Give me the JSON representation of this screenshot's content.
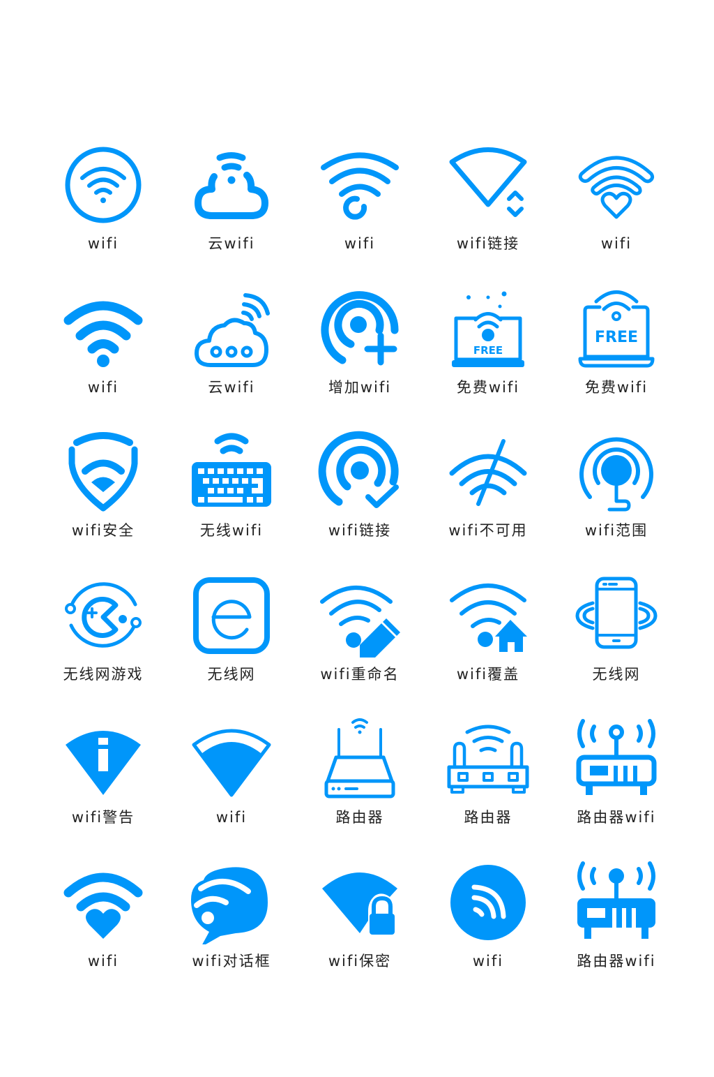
{
  "theme": {
    "icon_color": "#0096fa",
    "label_color": "#222222",
    "background": "#ffffff"
  },
  "icons": [
    {
      "label": "wifi",
      "icon": "wifi-circle-icon"
    },
    {
      "label": "云wifi",
      "icon": "cloud-wifi-icon"
    },
    {
      "label": "wifi",
      "icon": "wifi-swirl-icon"
    },
    {
      "label": "wifi链接",
      "icon": "wifi-sector-sort-icon"
    },
    {
      "label": "wifi",
      "icon": "wifi-heart-outline-icon"
    },
    {
      "label": "wifi",
      "icon": "wifi-solid-icon"
    },
    {
      "label": "云wifi",
      "icon": "cloud-signal-icon"
    },
    {
      "label": "增加wifi",
      "icon": "wifi-add-icon"
    },
    {
      "label": "免费wifi",
      "icon": "laptop-free-wifi-icon",
      "badge": "FREE"
    },
    {
      "label": "免费wifi",
      "icon": "laptop-free-wifi-outline-icon",
      "badge": "FREE"
    },
    {
      "label": "wifi安全",
      "icon": "wifi-shield-icon"
    },
    {
      "label": "无线wifi",
      "icon": "wireless-keyboard-icon"
    },
    {
      "label": "wifi链接",
      "icon": "wifi-connected-check-icon"
    },
    {
      "label": "wifi不可用",
      "icon": "wifi-off-icon"
    },
    {
      "label": "wifi范围",
      "icon": "wifi-range-icon"
    },
    {
      "label": "无线网游戏",
      "icon": "wireless-game-icon"
    },
    {
      "label": "无线网",
      "icon": "e-browser-icon"
    },
    {
      "label": "wifi重命名",
      "icon": "wifi-rename-pencil-icon"
    },
    {
      "label": "wifi覆盖",
      "icon": "wifi-home-icon"
    },
    {
      "label": "无线网",
      "icon": "phone-wireless-icon"
    },
    {
      "label": "wifi警告",
      "icon": "wifi-info-icon"
    },
    {
      "label": "wifi",
      "icon": "wifi-sector-icon"
    },
    {
      "label": "路由器",
      "icon": "router-outline-icon"
    },
    {
      "label": "路由器",
      "icon": "router-antennas-icon"
    },
    {
      "label": "路由器wifi",
      "icon": "router-wifi-outline-icon"
    },
    {
      "label": "wifi",
      "icon": "wifi-heart-icon"
    },
    {
      "label": "wifi对话框",
      "icon": "wifi-chat-bubble-icon"
    },
    {
      "label": "wifi保密",
      "icon": "wifi-lock-icon"
    },
    {
      "label": "wifi",
      "icon": "wifi-rss-circle-icon"
    },
    {
      "label": "路由器wifi",
      "icon": "router-wifi-solid-icon"
    }
  ]
}
